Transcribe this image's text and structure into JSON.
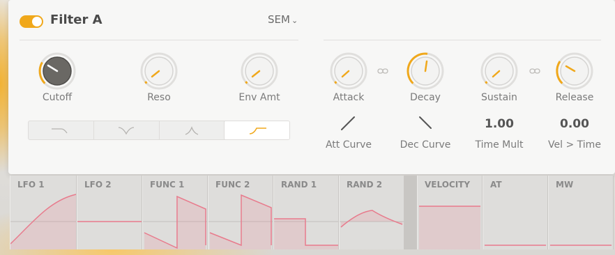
{
  "filter": {
    "title": "Filter A",
    "enabled": true,
    "type_value": "SEM",
    "type_chevron": "⌄",
    "accent_color": "#f0a81b"
  },
  "knobs": {
    "cutoff": {
      "label": "Cutoff"
    },
    "reso": {
      "label": "Reso"
    },
    "env_amt": {
      "label": "Env Amt"
    }
  },
  "envelope": {
    "attack": {
      "label": "Attack"
    },
    "decay": {
      "label": "Decay"
    },
    "sustain": {
      "label": "Sustain"
    },
    "release": {
      "label": "Release"
    },
    "link_icon": "link-icon"
  },
  "curves": {
    "att_curve": {
      "label": "Att Curve"
    },
    "dec_curve": {
      "label": "Dec Curve"
    },
    "time_mult": {
      "label": "Time Mult",
      "value": "1.00"
    },
    "vel_time": {
      "label": "Vel > Time",
      "value": "0.00"
    }
  },
  "filter_shapes": [
    "low-pass-shape",
    "notch-shape",
    "band-pass-shape",
    "high-pass-shape"
  ],
  "mod_sources": [
    {
      "label": "LFO 1"
    },
    {
      "label": "LFO 2"
    },
    {
      "label": "FUNC 1"
    },
    {
      "label": "FUNC 2"
    },
    {
      "label": "RAND 1"
    },
    {
      "label": "RAND 2"
    },
    {
      "label": "VELOCITY"
    },
    {
      "label": "AT"
    },
    {
      "label": "MW"
    }
  ]
}
